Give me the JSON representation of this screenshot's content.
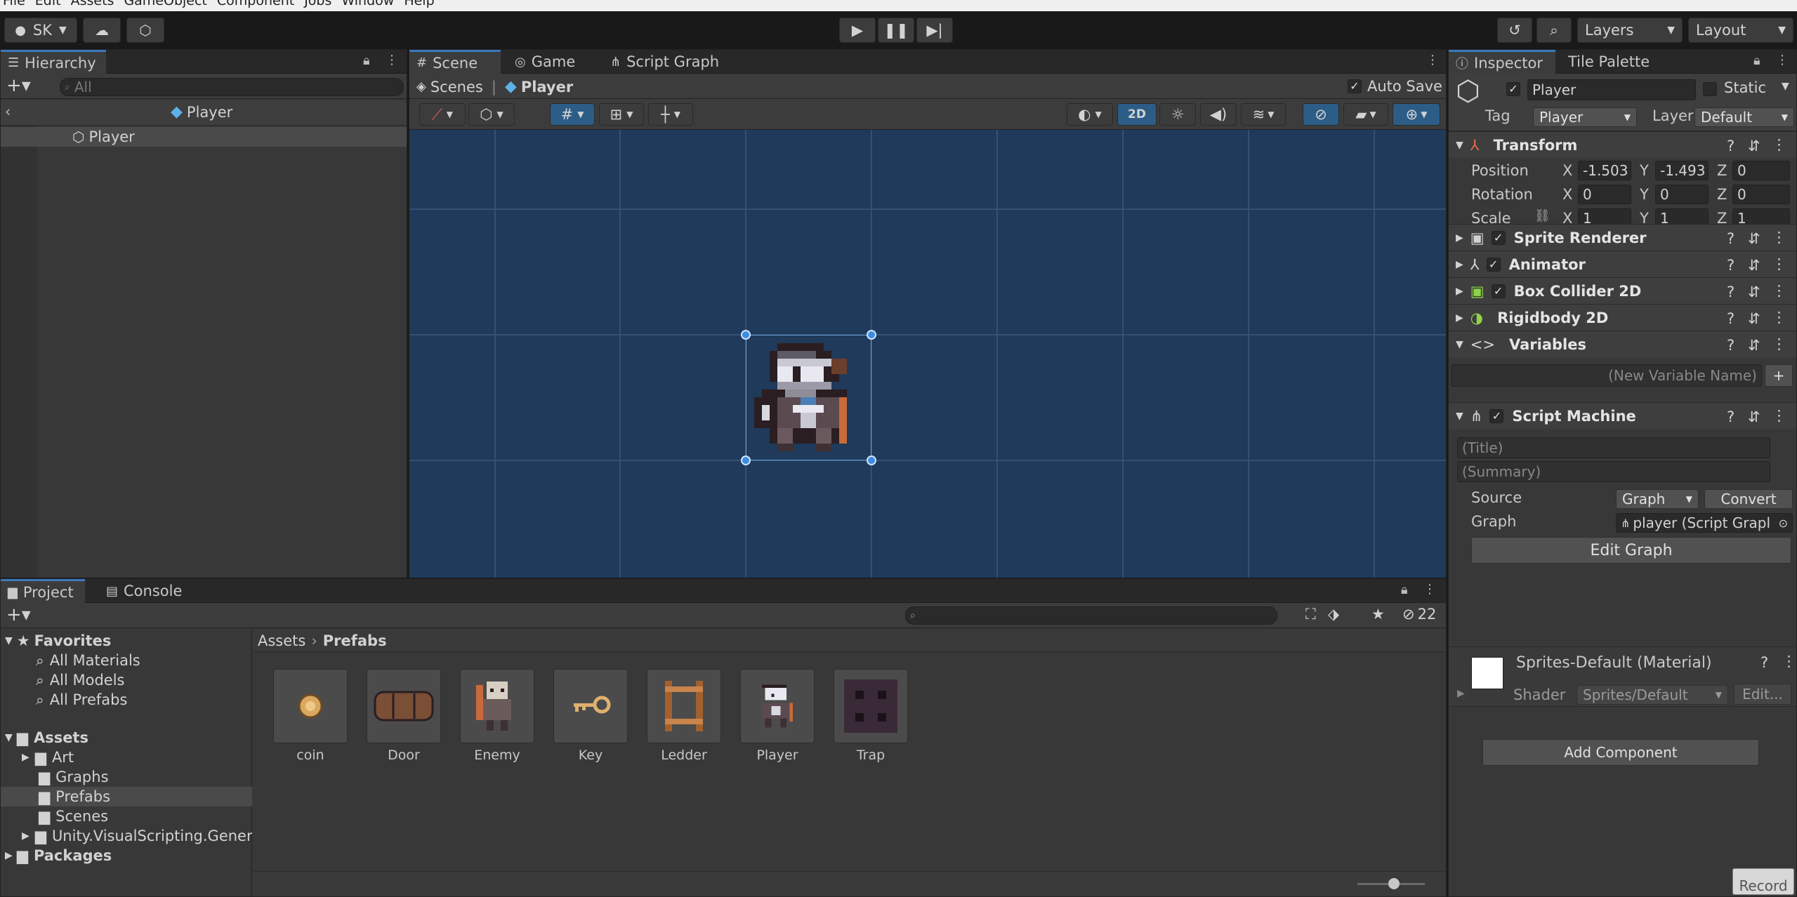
{
  "menu": [
    "File",
    "Edit",
    "Assets",
    "GameObject",
    "Component",
    "Jobs",
    "Window",
    "Help"
  ],
  "toolbar": {
    "account": "SK",
    "layers": "Layers",
    "layout": "Layout"
  },
  "hierarchy": {
    "tab": "Hierarchy",
    "search_placeholder": "All",
    "breadcrumb": "Player",
    "item": "Player"
  },
  "scene": {
    "tabs": [
      "Scene",
      "Game",
      "Script Graph"
    ],
    "crumb_root": "Scenes",
    "crumb_leaf": "Player",
    "autosave": "Auto Save",
    "btn_2d": "2D"
  },
  "project": {
    "tabs": [
      "Project",
      "Console"
    ],
    "hidden_count": "22",
    "favorites": "Favorites",
    "fav_items": [
      "All Materials",
      "All Models",
      "All Prefabs"
    ],
    "assets": "Assets",
    "asset_folders": [
      "Art",
      "Graphs",
      "Prefabs",
      "Scenes",
      "Unity.VisualScripting.Genera"
    ],
    "packages": "Packages",
    "path_root": "Assets",
    "path_leaf": "Prefabs",
    "items": [
      "coin",
      "Door",
      "Enemy",
      "Key",
      "Ledder",
      "Player",
      "Trap"
    ]
  },
  "inspector": {
    "tabs": [
      "Inspector",
      "Tile Palette"
    ],
    "object_name": "Player",
    "static": "Static",
    "tag_label": "Tag",
    "tag": "Player",
    "layer_label": "Layer",
    "layer": "Default",
    "transform": {
      "title": "Transform",
      "rows": [
        {
          "label": "Position",
          "x": "-1.503",
          "y": "-1.493",
          "z": "0"
        },
        {
          "label": "Rotation",
          "x": "0",
          "y": "0",
          "z": "0"
        },
        {
          "label": "Scale",
          "x": "1",
          "y": "1",
          "z": "1"
        }
      ],
      "axis": [
        "X",
        "Y",
        "Z"
      ]
    },
    "components": [
      "Sprite Renderer",
      "Animator",
      "Box Collider 2D",
      "Rigidbody 2D",
      "Variables"
    ],
    "new_var_placeholder": "(New Variable Name)",
    "script_machine": {
      "title": "Script Machine",
      "title_placeholder": "(Title)",
      "summary_placeholder": "(Summary)",
      "source_label": "Source",
      "source": "Graph",
      "convert": "Convert",
      "graph_label": "Graph",
      "graph": "player (Script Grapl",
      "edit_graph": "Edit Graph"
    },
    "material": {
      "name": "Sprites-Default (Material)",
      "shader_label": "Shader",
      "shader": "Sprites/Default",
      "edit": "Edit..."
    },
    "add_component": "Add Component"
  },
  "status": {
    "record": "Record"
  },
  "colors": {
    "scene_bg": "#1f3a5a",
    "accent": "#3a79bb",
    "selection": "#2c5d87"
  }
}
